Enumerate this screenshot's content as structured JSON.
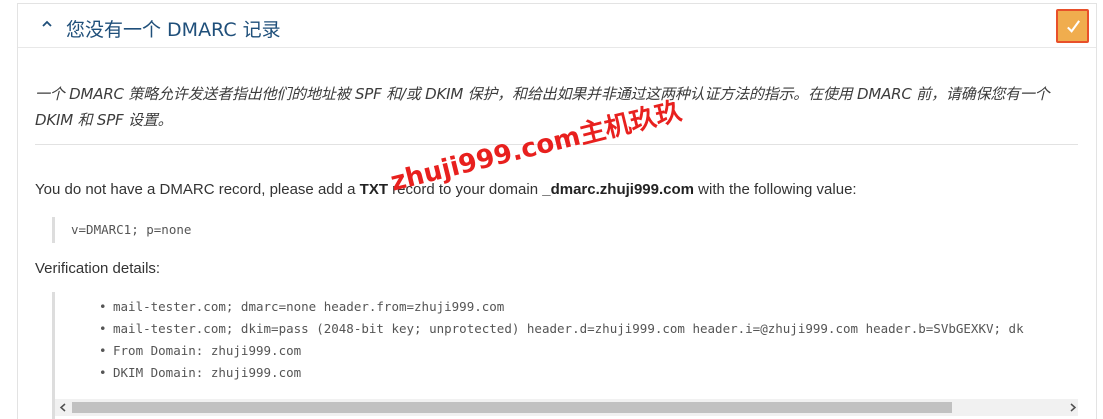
{
  "header": {
    "title": "您没有一个 DMARC 记录",
    "status_icon": "check-icon",
    "status_color": "#f0ad4e"
  },
  "description": "一个 DMARC 策略允许发送者指出他们的地址被 SPF 和/或 DKIM 保护，和给出如果并非通过这两种认证方法的指示。在使用 DMARC 前，请确保您有一个 DKIM 和 SPF 设置。",
  "message": {
    "prefix": "You do not have a DMARC record, please add a ",
    "record_type": "TXT",
    "middle": " record to your domain ",
    "domain": "_dmarc.zhuji999.com",
    "suffix": " with the following value:"
  },
  "record_value": "v=DMARC1; p=none",
  "verification": {
    "label": "Verification details:",
    "items": [
      "mail-tester.com; dmarc=none header.from=zhuji999.com",
      "mail-tester.com; dkim=pass (2048-bit key; unprotected) header.d=zhuji999.com header.i=@zhuji999.com header.b=SVbGEXKV; dk",
      "From Domain: zhuji999.com",
      "DKIM Domain: zhuji999.com"
    ]
  },
  "watermark": "zhuji999.com主机玖玖"
}
